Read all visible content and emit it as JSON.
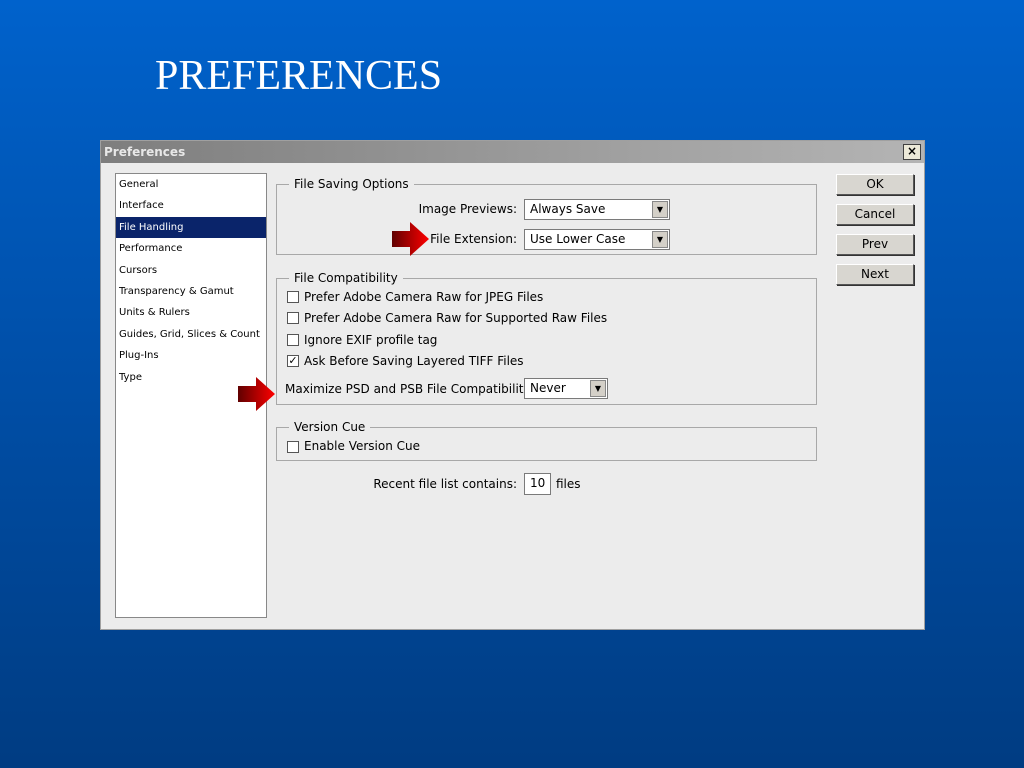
{
  "slide_title": "PREFERENCES",
  "dialog": {
    "title": "Preferences",
    "close": "×"
  },
  "categories": [
    "General",
    "Interface",
    "File Handling",
    "Performance",
    "Cursors",
    "Transparency & Gamut",
    "Units & Rulers",
    "Guides, Grid, Slices & Count",
    "Plug-Ins",
    "Type"
  ],
  "selected_category": "File Handling",
  "file_saving": {
    "label": "File Saving Options",
    "image_previews_label": "Image Previews:",
    "image_previews_value": "Always Save",
    "file_extension_label": "File Extension:",
    "file_extension_value": "Use Lower Case"
  },
  "file_compat": {
    "label": "File Compatibility",
    "checkboxes": [
      {
        "label": "Prefer Adobe Camera Raw for JPEG Files",
        "checked": false
      },
      {
        "label": "Prefer Adobe Camera Raw for Supported Raw Files",
        "checked": false
      },
      {
        "label": "Ignore EXIF profile tag",
        "checked": false
      },
      {
        "label": "Ask Before Saving Layered TIFF Files",
        "checked": true
      }
    ],
    "maximize_label": "Maximize PSD and PSB File Compatibility:",
    "maximize_value": "Never"
  },
  "version_cue": {
    "label": "Version Cue",
    "enable_label": "Enable Version Cue",
    "checked": false
  },
  "recent": {
    "label": "Recent file list contains:",
    "value": "10",
    "suffix": "files"
  },
  "buttons": {
    "ok": "OK",
    "cancel": "Cancel",
    "prev": "Prev",
    "next": "Next"
  },
  "colors": {
    "arrow": "#e00000",
    "selection": "#0a246a"
  }
}
